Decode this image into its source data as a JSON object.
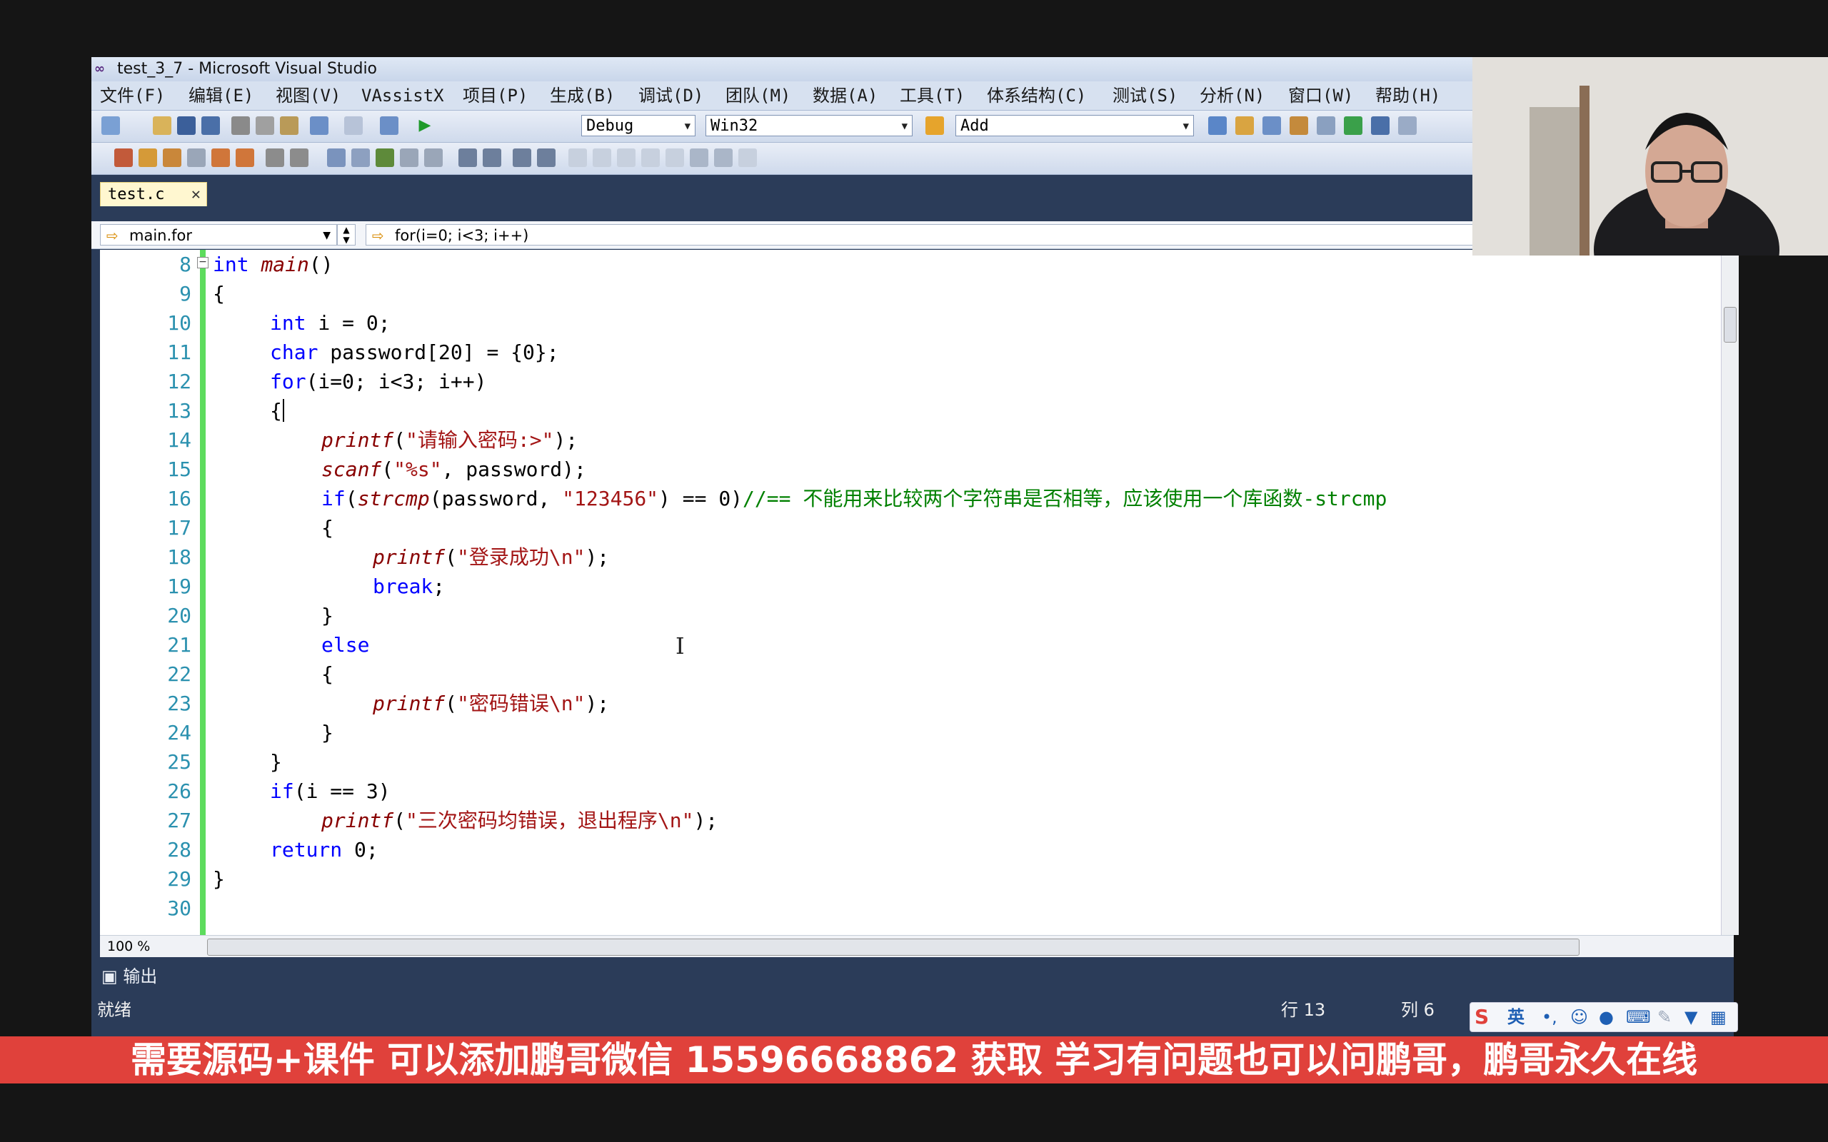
{
  "window": {
    "title": "test_3_7 - Microsoft Visual Studio"
  },
  "menu": [
    "文件(F)",
    "编辑(E)",
    "视图(V)",
    "VAssistX",
    "项目(P)",
    "生成(B)",
    "调试(D)",
    "团队(M)",
    "数据(A)",
    "工具(T)",
    "体系结构(C)",
    "测试(S)",
    "分析(N)",
    "窗口(W)",
    "帮助(H)"
  ],
  "toolbar": {
    "config": "Debug",
    "platform": "Win32",
    "find_text": "Add"
  },
  "tab": {
    "label": "test.c",
    "close": "✕"
  },
  "nav": {
    "scope": "main.for",
    "member": "for(i=0; i<3; i++)"
  },
  "editor": {
    "line_numbers": [
      "8",
      "9",
      "10",
      "11",
      "12",
      "13",
      "14",
      "15",
      "16",
      "17",
      "18",
      "19",
      "20",
      "21",
      "22",
      "23",
      "24",
      "25",
      "26",
      "27",
      "28",
      "29",
      "30"
    ],
    "lines": {
      "l8_kw": "int ",
      "l8_fn": "main",
      "l8_rest": "()",
      "l9": "{",
      "l10_kw": "int",
      "l10_rest": " i = 0;",
      "l11_kw": "char",
      "l11_rest": " password[20] = {0};",
      "l12_kw": "for",
      "l12_rest": "(i=0; i<3; i++)",
      "l13": "{",
      "l14_fn": "printf",
      "l14_a": "(",
      "l14_str": "\"请输入密码:>\"",
      "l14_b": ");",
      "l15_fn": "scanf",
      "l15_a": "(",
      "l15_str": "\"%s\"",
      "l15_b": ", password);",
      "l16_kw": "if",
      "l16_a": "(",
      "l16_fn": "strcmp",
      "l16_b": "(password, ",
      "l16_str": "\"123456\"",
      "l16_c": ") == 0)",
      "l16_cmt": "//== 不能用来比较两个字符串是否相等，应该使用一个库函数-strcmp",
      "l17": "{",
      "l18_fn": "printf",
      "l18_a": "(",
      "l18_str": "\"登录成功\\n\"",
      "l18_b": ");",
      "l19_kw": "break",
      "l19_rest": ";",
      "l20": "}",
      "l21_kw": "else",
      "l22": "{",
      "l23_fn": "printf",
      "l23_a": "(",
      "l23_str": "\"密码错误\\n\"",
      "l23_b": ");",
      "l24": "}",
      "l25": "}",
      "l26_kw": "if",
      "l26_rest": "(i == 3)",
      "l27_fn": "printf",
      "l27_a": "(",
      "l27_str": "\"三次密码均错误，退出程序\\n\"",
      "l27_b": ");",
      "l28_kw": "return",
      "l28_rest": " 0;",
      "l29": "}"
    }
  },
  "zoom": "100 %",
  "output_tab": "输出",
  "status": {
    "ready": "就绪",
    "row": "行 13",
    "col": "列 6"
  },
  "ime": {
    "lang": "英"
  },
  "banner": "需要源码+课件 可以添加鹏哥微信 15596668862 获取 学习有问题也可以问鹏哥，鹏哥永久在线",
  "colors": {
    "accent": "#2b3c59",
    "banner": "#e0413b",
    "keyword": "#0000ff",
    "string": "#a31515",
    "comment": "#008000",
    "line_number": "#2b91af"
  }
}
